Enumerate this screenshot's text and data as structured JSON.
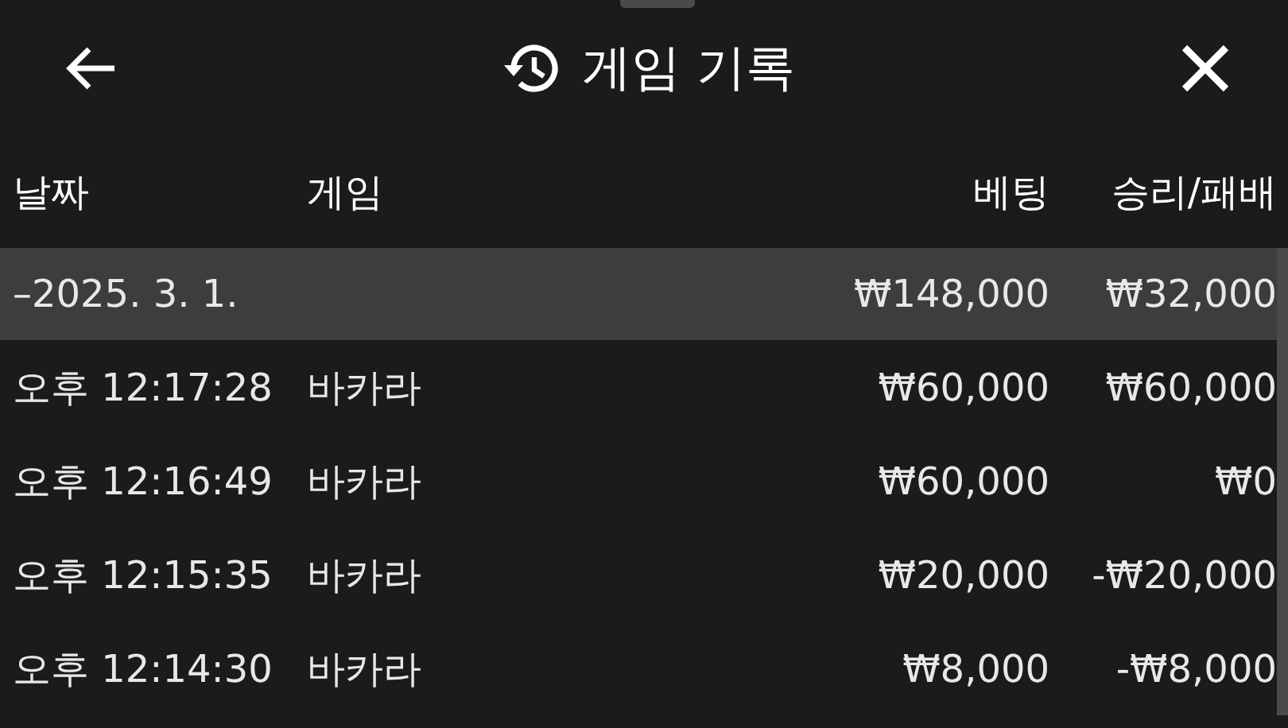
{
  "header": {
    "title": "게임 기록"
  },
  "table": {
    "columns": [
      "날짜",
      "게임",
      "베팅",
      "승리/패배"
    ],
    "groups": [
      {
        "date": "–2025. 3. 1.",
        "bet": "₩148,000",
        "result": "₩32,000",
        "selected": true,
        "rows": [
          {
            "time": "오후 12:17:28",
            "game": "바카라",
            "bet": "₩60,000",
            "result": "₩60,000"
          },
          {
            "time": "오후 12:16:49",
            "game": "바카라",
            "bet": "₩60,000",
            "result": "₩0"
          },
          {
            "time": "오후 12:15:35",
            "game": "바카라",
            "bet": "₩20,000",
            "result": "-₩20,000"
          },
          {
            "time": "오후 12:14:30",
            "game": "바카라",
            "bet": "₩8,000",
            "result": "-₩8,000"
          }
        ]
      }
    ]
  }
}
